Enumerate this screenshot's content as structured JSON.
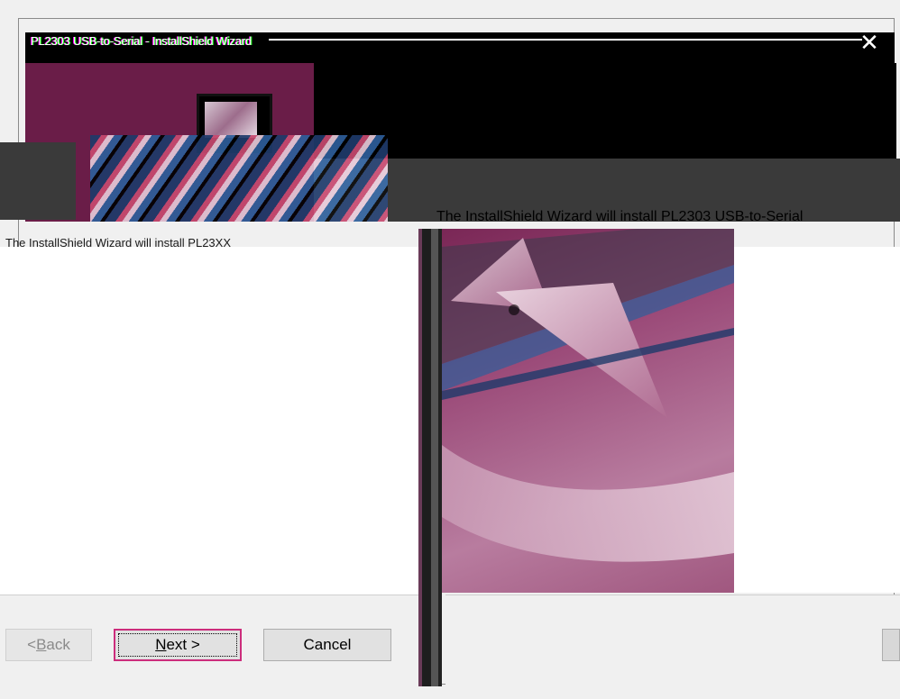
{
  "window": {
    "title": "PL2303 USB-to-Serial - InstallShield Wizard",
    "close_glyph": "✕"
  },
  "welcome": {
    "body_text": "The InstallShield Wizard will install PL2303 USB-to-Serial",
    "subtitle_garbled": "The InstallShield Wizard will install PL23XX"
  },
  "buttons": {
    "back_prefix": "< ",
    "back_accel": "B",
    "back_rest": "ack",
    "next_accel": "N",
    "next_rest": "ext >",
    "cancel_label": "Cancel"
  },
  "colors": {
    "accent_focus": "#cc2d7c",
    "header_maroon": "#6a1d48"
  }
}
